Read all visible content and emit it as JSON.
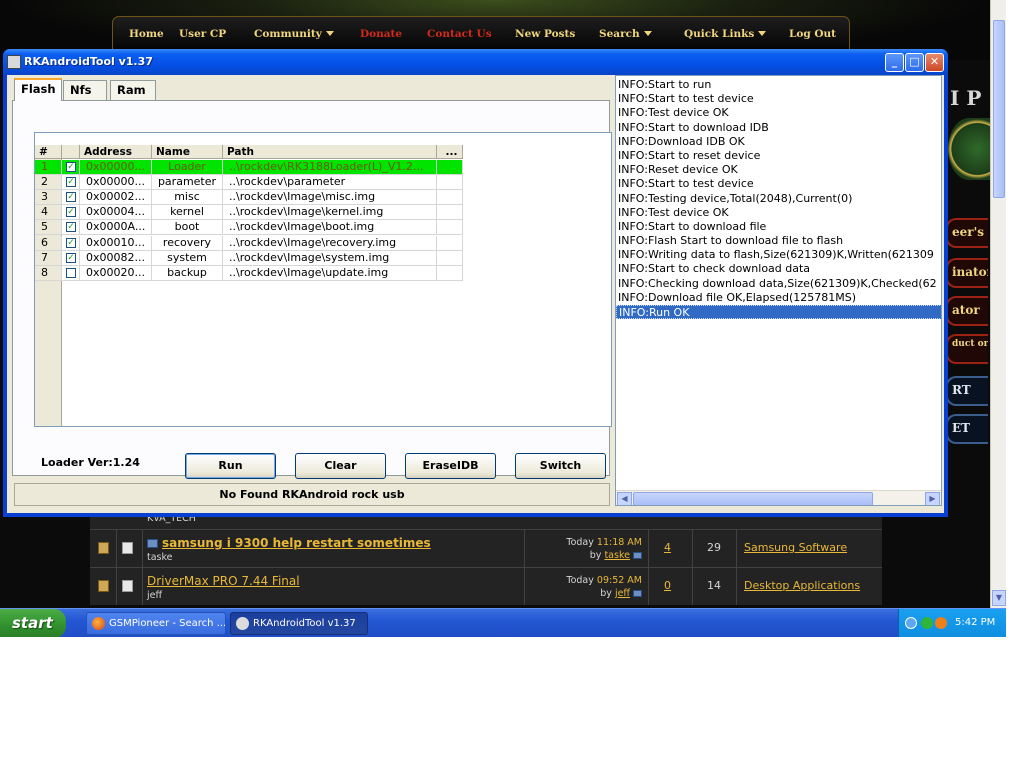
{
  "site": {
    "nav": [
      {
        "label": "Home",
        "caret": false,
        "red": false
      },
      {
        "label": "User CP",
        "caret": false,
        "red": false
      },
      {
        "label": "Community",
        "caret": true,
        "red": false
      },
      {
        "label": "Donate",
        "caret": false,
        "red": true
      },
      {
        "label": "Contact Us",
        "caret": false,
        "red": true
      },
      {
        "label": "New Posts",
        "caret": false,
        "red": false
      },
      {
        "label": "Search",
        "caret": true,
        "red": false
      },
      {
        "label": "Quick Links",
        "caret": true,
        "red": false
      },
      {
        "label": "Log Out",
        "caret": false,
        "red": false
      }
    ],
    "side_letters": "I P",
    "side_buttons": [
      "eer's",
      "inator",
      "ator",
      "duct orter",
      "RT",
      "ET"
    ],
    "partial_author": "KVA_TECH",
    "rows": [
      {
        "title": "samsung i 9300 help restart sometimes",
        "author": "taske",
        "time_prefix": "Today",
        "time": "11:18 AM",
        "by": "by",
        "by_user": "taske",
        "replies": "4",
        "views": "29",
        "forum": "Samsung Software",
        "bold": true,
        "icon": "arrow"
      },
      {
        "title": "DriverMax PRO 7.44 Final",
        "author": "jeff",
        "time_prefix": "Today",
        "time": "09:52 AM",
        "by": "by",
        "by_user": "jeff",
        "replies": "0",
        "views": "14",
        "forum": "Desktop Applications",
        "bold": false,
        "icon": "none"
      }
    ]
  },
  "taskbar": {
    "start": "start",
    "tasks": [
      {
        "label": "GSMPioneer - Search ...",
        "active": false
      },
      {
        "label": "RKAndroidTool v1.37",
        "active": true
      }
    ],
    "clock": "5:42 PM"
  },
  "window": {
    "title": "RKAndroidTool v1.37",
    "tabs": [
      "Flash",
      "Nfs",
      "Ram"
    ],
    "active_tab": "Flash",
    "grid": {
      "headers": [
        "#",
        "",
        "Address",
        "Name",
        "Path",
        "..."
      ],
      "rows": [
        {
          "num": "1",
          "checked": true,
          "address": "0x00000...",
          "name": "Loader",
          "path": "..\\rockdev\\RK3188Loader(L)_V1.2...",
          "selected": true
        },
        {
          "num": "2",
          "checked": true,
          "address": "0x00000...",
          "name": "parameter",
          "path": "..\\rockdev\\parameter",
          "selected": false
        },
        {
          "num": "3",
          "checked": true,
          "address": "0x00002...",
          "name": "misc",
          "path": "..\\rockdev\\Image\\misc.img",
          "selected": false
        },
        {
          "num": "4",
          "checked": true,
          "address": "0x00004...",
          "name": "kernel",
          "path": "..\\rockdev\\Image\\kernel.img",
          "selected": false
        },
        {
          "num": "5",
          "checked": true,
          "address": "0x0000A...",
          "name": "boot",
          "path": "..\\rockdev\\Image\\boot.img",
          "selected": false
        },
        {
          "num": "6",
          "checked": true,
          "address": "0x00010...",
          "name": "recovery",
          "path": "..\\rockdev\\Image\\recovery.img",
          "selected": false
        },
        {
          "num": "7",
          "checked": true,
          "address": "0x00082...",
          "name": "system",
          "path": "..\\rockdev\\Image\\system.img",
          "selected": false
        },
        {
          "num": "8",
          "checked": false,
          "address": "0x00020...",
          "name": "backup",
          "path": "..\\rockdev\\Image\\update.img",
          "selected": false
        }
      ]
    },
    "loader_ver": "Loader Ver:1.24",
    "buttons": [
      "Run",
      "Clear",
      "EraseIDB",
      "Switch"
    ],
    "status": "No Found RKAndroid rock usb",
    "log": [
      "INFO:Start to run",
      "INFO:Start to test device",
      "INFO:Test device OK",
      "INFO:Start to download IDB",
      "INFO:Download IDB OK",
      "INFO:Start to reset device",
      "INFO:Reset device OK",
      "INFO:Start to test device",
      "INFO:Testing device,Total(2048),Current(0)",
      "INFO:Test device OK",
      "INFO:Start to download file",
      "INFO:Flash Start to download file to flash",
      "INFO:Writing data to flash,Size(621309)K,Written(621309",
      "INFO:Start to check download data",
      "INFO:Checking download data,Size(621309)K,Checked(62",
      "INFO:Download file OK,Elapsed(125781MS)",
      "INFO:Run OK"
    ],
    "log_selected_index": 16
  }
}
